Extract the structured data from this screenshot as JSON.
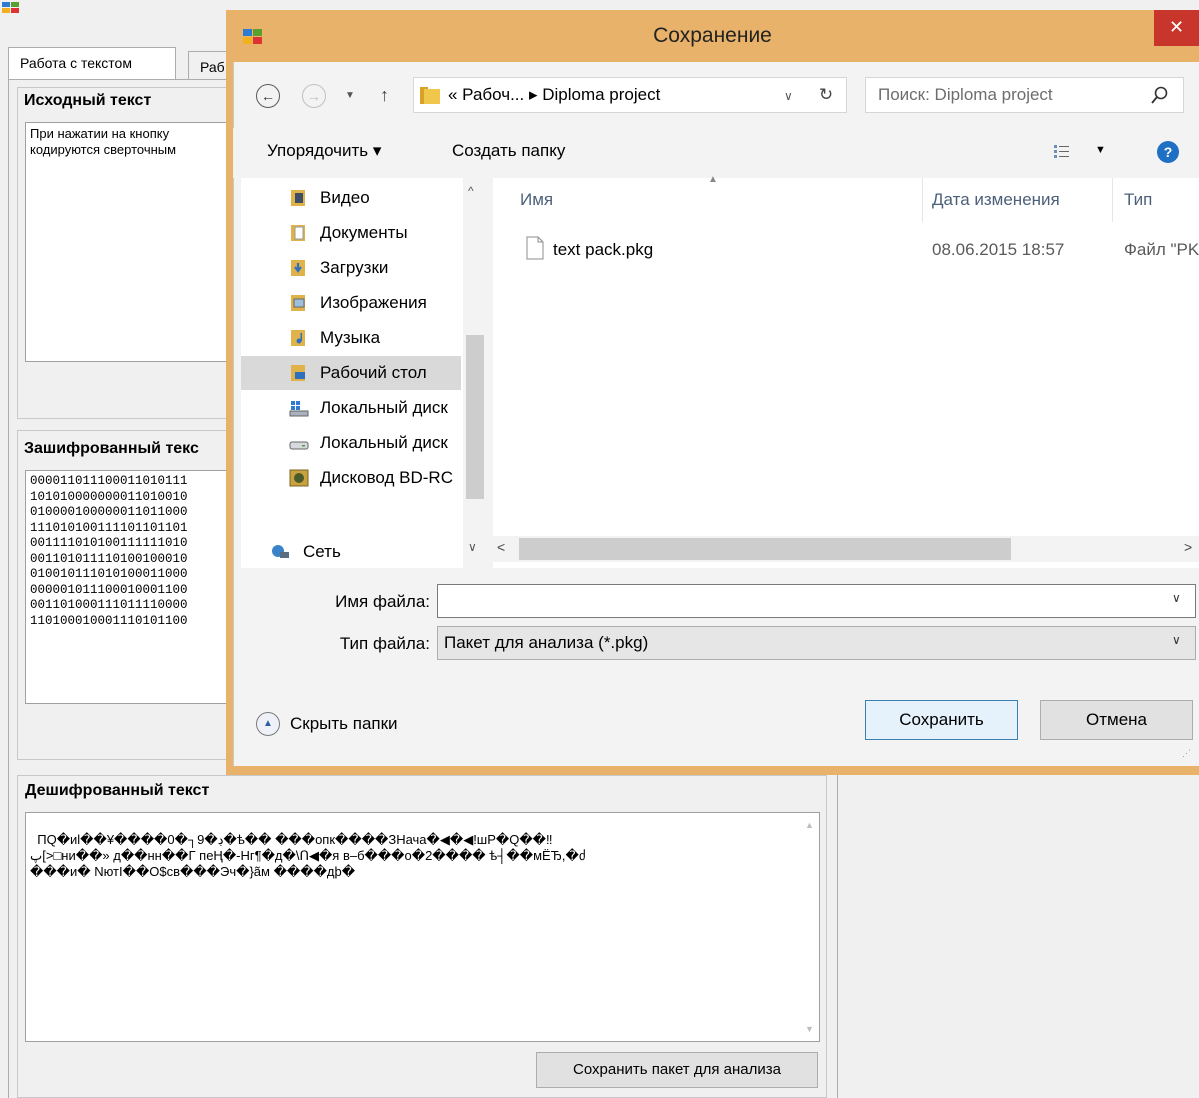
{
  "app": {
    "tabs": [
      "Работа с текстом",
      "Раб"
    ],
    "source_group": {
      "title": "Исходный текст",
      "text": "При нажатии на кнопку\nкодируются сверточным"
    },
    "encrypted_group": {
      "title": "Зашифрованный текс",
      "lines": [
        "000011011100011010111",
        "101010000000011010010",
        "010000100000011011000",
        "111010100111101101101",
        "001111010100111111010",
        "001101011110100100010",
        "010010111010100011000",
        "000001011100010001100",
        "001101000111011110000",
        "110100010001110101100"
      ]
    },
    "decrypted_group": {
      "title": "Дешифрованный текст",
      "text": "ПQ�иl��¥����0�┐9�ڊ�ѣ�� ���опк����ЗНача�◀�◀!шР�Q��‼\nپ[>□ни��» д��нн��Г пеҢ�-Нг¶�д�\\Ո◀�я в–б���о�2���� ѣ┤��мЁЂ,�ძ\n���и� NютI��О$св���Эч�}ãм ����дþ�"
    },
    "save_package_button": "Сохранить пакет для анализа"
  },
  "dialog": {
    "title": "Сохранение",
    "close_glyph": "✕",
    "address": {
      "path_text": "« Рабоч...  ▸  Diploma project",
      "search_placeholder": "Поиск: Diploma project"
    },
    "toolbar": {
      "organize": "Упорядочить ▾",
      "new_folder": "Создать папку",
      "help_glyph": "?"
    },
    "nav_items": [
      {
        "label": "Видео",
        "icon": "video-folder-icon"
      },
      {
        "label": "Документы",
        "icon": "documents-folder-icon"
      },
      {
        "label": "Загрузки",
        "icon": "downloads-folder-icon"
      },
      {
        "label": "Изображения",
        "icon": "pictures-folder-icon"
      },
      {
        "label": "Музыка",
        "icon": "music-folder-icon"
      },
      {
        "label": "Рабочий стол",
        "icon": "desktop-folder-icon",
        "selected": true
      },
      {
        "label": "Локальный диск",
        "icon": "local-disk-icon"
      },
      {
        "label": "Локальный диск",
        "icon": "drive-icon"
      },
      {
        "label": "Дисковод BD-RC",
        "icon": "bd-drive-icon"
      }
    ],
    "network_label": "Сеть",
    "columns": {
      "name": "Имя",
      "date": "Дата изменения",
      "type": "Тип"
    },
    "files": [
      {
        "name": "text pack.pkg",
        "date": "08.06.2015 18:57",
        "type": "Файл \"PKG\""
      }
    ],
    "filename_label": "Имя файла:",
    "filename_value": "",
    "filetype_label": "Тип файла:",
    "filetype_value": "Пакет для анализа (*.pkg)",
    "hide_folders": "Скрыть папки",
    "save_button": "Сохранить",
    "cancel_button": "Отмена"
  }
}
